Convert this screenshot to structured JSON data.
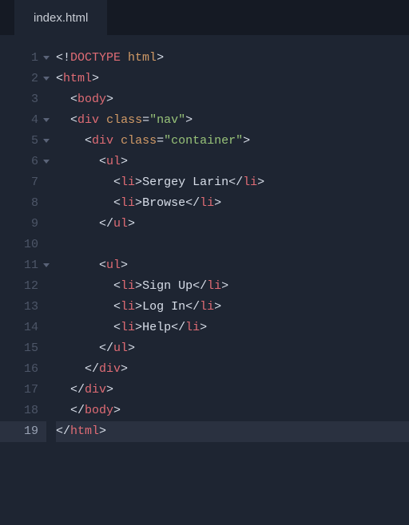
{
  "tabs": {
    "active": "index.html"
  },
  "gutter": {
    "1": "1",
    "2": "2",
    "3": "3",
    "4": "4",
    "5": "5",
    "6": "6",
    "7": "7",
    "8": "8",
    "9": "9",
    "10": "10",
    "11": "11",
    "12": "12",
    "13": "13",
    "14": "14",
    "15": "15",
    "16": "16",
    "17": "17",
    "18": "18",
    "19": "19"
  },
  "code": {
    "l1": {
      "open": "<!",
      "doctype": "DOCTYPE",
      "sp": " ",
      "html": "html",
      "close": ">"
    },
    "l2": {
      "open": "<",
      "tag": "html",
      "close": ">"
    },
    "l3": {
      "indent": "  ",
      "open": "<",
      "tag": "body",
      "close": ">"
    },
    "l4": {
      "indent": "  ",
      "open": "<",
      "tag": "div",
      "sp": " ",
      "attr": "class",
      "eq": "=",
      "val": "\"nav\"",
      "close": ">"
    },
    "l5": {
      "indent": "    ",
      "open": "<",
      "tag": "div",
      "sp": " ",
      "attr": "class",
      "eq": "=",
      "val": "\"container\"",
      "close": ">"
    },
    "l6": {
      "indent": "      ",
      "open": "<",
      "tag": "ul",
      "close": ">"
    },
    "l7": {
      "indent": "        ",
      "open": "<",
      "tag": "li",
      "close": ">",
      "text": "Sergey Larin",
      "open2": "</",
      "tag2": "li",
      "close2": ">"
    },
    "l8": {
      "indent": "        ",
      "open": "<",
      "tag": "li",
      "close": ">",
      "text": "Browse",
      "open2": "</",
      "tag2": "li",
      "close2": ">"
    },
    "l9": {
      "indent": "      ",
      "open": "</",
      "tag": "ul",
      "close": ">"
    },
    "l10": {
      "indent": ""
    },
    "l11": {
      "indent": "      ",
      "open": "<",
      "tag": "ul",
      "close": ">"
    },
    "l12": {
      "indent": "        ",
      "open": "<",
      "tag": "li",
      "close": ">",
      "text": "Sign Up",
      "open2": "</",
      "tag2": "li",
      "close2": ">"
    },
    "l13": {
      "indent": "        ",
      "open": "<",
      "tag": "li",
      "close": ">",
      "text": "Log In",
      "open2": "</",
      "tag2": "li",
      "close2": ">"
    },
    "l14": {
      "indent": "        ",
      "open": "<",
      "tag": "li",
      "close": ">",
      "text": "Help",
      "open2": "</",
      "tag2": "li",
      "close2": ">"
    },
    "l15": {
      "indent": "      ",
      "open": "</",
      "tag": "ul",
      "close": ">"
    },
    "l16": {
      "indent": "    ",
      "open": "</",
      "tag": "div",
      "close": ">"
    },
    "l17": {
      "indent": "  ",
      "open": "</",
      "tag": "div",
      "close": ">"
    },
    "l18": {
      "indent": "  ",
      "open": "</",
      "tag": "body",
      "close": ">"
    },
    "l19": {
      "open": "</",
      "tag": "html",
      "close": ">"
    }
  }
}
